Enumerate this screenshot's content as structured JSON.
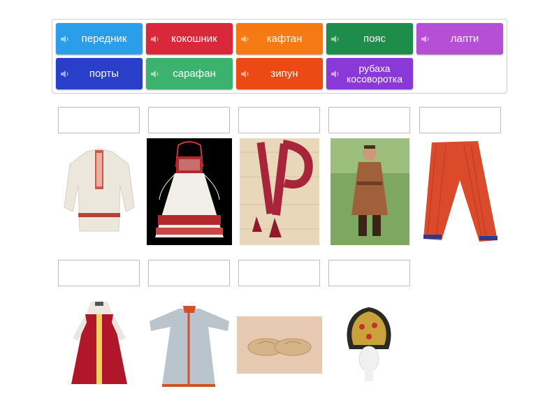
{
  "word_bank": {
    "tiles": [
      {
        "label": "передник",
        "color": "#2a9ee8"
      },
      {
        "label": "кокошник",
        "color": "#d8283a"
      },
      {
        "label": "кафтан",
        "color": "#f57a14"
      },
      {
        "label": "пояс",
        "color": "#1e8c4a"
      },
      {
        "label": "лапти",
        "color": "#b64ed6"
      },
      {
        "label": "порты",
        "color": "#2a3fc9"
      },
      {
        "label": "сарафан",
        "color": "#3bb36f"
      },
      {
        "label": "зипун",
        "color": "#ec4a14"
      },
      {
        "label": "рубаха косоворотка",
        "color": "#8a39d8"
      }
    ]
  },
  "images": [
    {
      "name": "shirt-image"
    },
    {
      "name": "apron-image"
    },
    {
      "name": "belt-image"
    },
    {
      "name": "man-in-costume-image"
    },
    {
      "name": "trousers-image"
    },
    {
      "name": "sarafan-dress-image"
    },
    {
      "name": "coat-image"
    },
    {
      "name": "bast-shoes-image"
    },
    {
      "name": "kokoshnik-headdress-image"
    }
  ],
  "icons": {
    "tile_icon": "speaker-icon"
  }
}
